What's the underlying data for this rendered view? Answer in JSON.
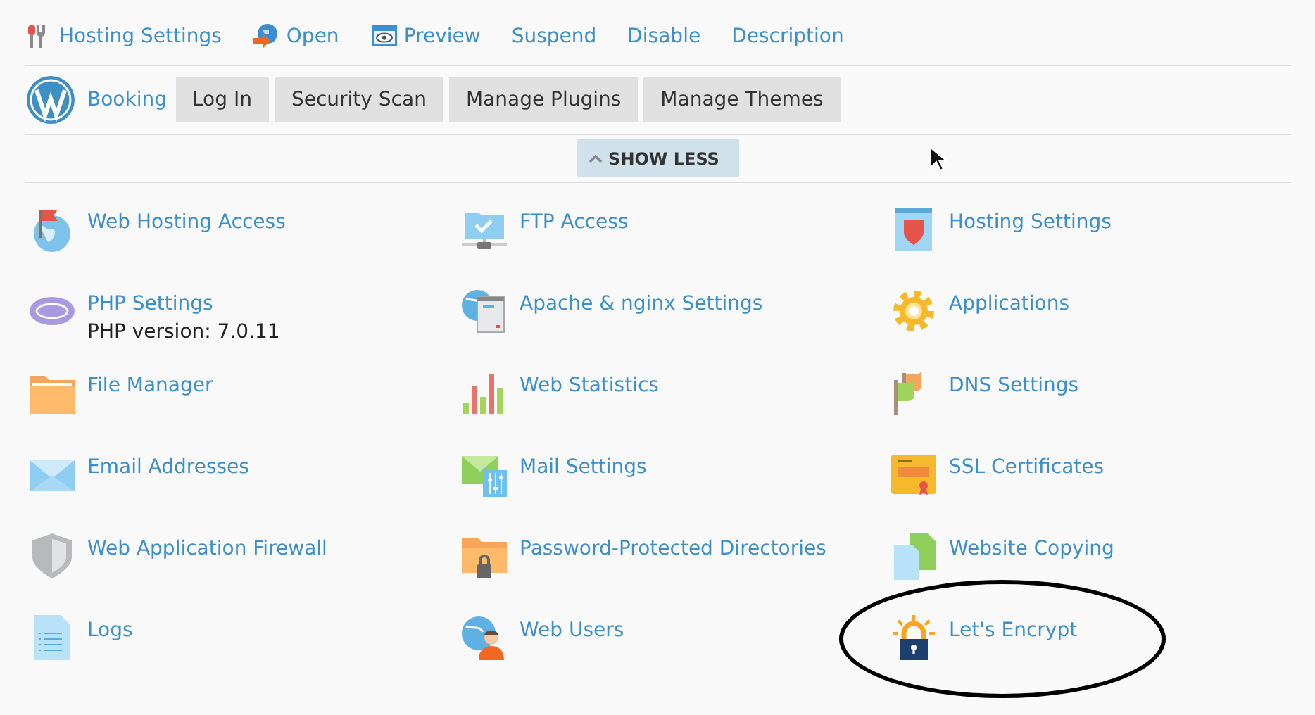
{
  "action_links": [
    {
      "label": "Hosting Settings"
    },
    {
      "label": "Open"
    },
    {
      "label": "Preview"
    },
    {
      "label": "Suspend"
    },
    {
      "label": "Disable"
    },
    {
      "label": "Description"
    }
  ],
  "wordpress": {
    "site": "Booking",
    "buttons": [
      "Log In",
      "Security Scan",
      "Manage Plugins",
      "Manage Themes"
    ]
  },
  "toggle": {
    "label": "SHOW LESS",
    "expanded": true
  },
  "tools": [
    {
      "label": "Web Hosting Access",
      "circled": false
    },
    {
      "label": "FTP Access",
      "circled": false
    },
    {
      "label": "Hosting Settings",
      "circled": false
    },
    {
      "label": "PHP Settings",
      "detail": "PHP version: 7.0.11",
      "circled": false
    },
    {
      "label": "Apache & nginx Settings",
      "circled": false
    },
    {
      "label": "Applications",
      "circled": false
    },
    {
      "label": "File Manager",
      "circled": false
    },
    {
      "label": "Web Statistics",
      "circled": false
    },
    {
      "label": "DNS Settings",
      "circled": false
    },
    {
      "label": "Email Addresses",
      "circled": false
    },
    {
      "label": "Mail Settings",
      "circled": false
    },
    {
      "label": "SSL Certificates",
      "circled": false
    },
    {
      "label": "Web Application Firewall",
      "circled": false
    },
    {
      "label": "Password-Protected Directories",
      "circled": false
    },
    {
      "label": "Website Copying",
      "circled": false
    },
    {
      "label": "Logs",
      "circled": false
    },
    {
      "label": "Web Users",
      "circled": false
    },
    {
      "label": "Let's Encrypt",
      "circled": true
    }
  ]
}
